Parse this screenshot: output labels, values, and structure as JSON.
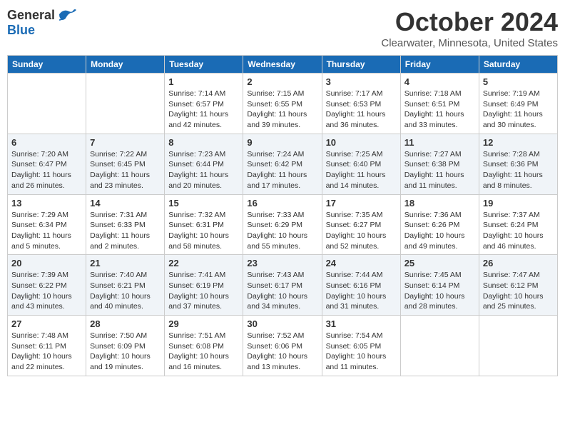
{
  "header": {
    "logo_general": "General",
    "logo_blue": "Blue",
    "month_title": "October 2024",
    "location": "Clearwater, Minnesota, United States"
  },
  "weekdays": [
    "Sunday",
    "Monday",
    "Tuesday",
    "Wednesday",
    "Thursday",
    "Friday",
    "Saturday"
  ],
  "weeks": [
    [
      {
        "day": "",
        "info": ""
      },
      {
        "day": "",
        "info": ""
      },
      {
        "day": "1",
        "info": "Sunrise: 7:14 AM\nSunset: 6:57 PM\nDaylight: 11 hours and 42 minutes."
      },
      {
        "day": "2",
        "info": "Sunrise: 7:15 AM\nSunset: 6:55 PM\nDaylight: 11 hours and 39 minutes."
      },
      {
        "day": "3",
        "info": "Sunrise: 7:17 AM\nSunset: 6:53 PM\nDaylight: 11 hours and 36 minutes."
      },
      {
        "day": "4",
        "info": "Sunrise: 7:18 AM\nSunset: 6:51 PM\nDaylight: 11 hours and 33 minutes."
      },
      {
        "day": "5",
        "info": "Sunrise: 7:19 AM\nSunset: 6:49 PM\nDaylight: 11 hours and 30 minutes."
      }
    ],
    [
      {
        "day": "6",
        "info": "Sunrise: 7:20 AM\nSunset: 6:47 PM\nDaylight: 11 hours and 26 minutes."
      },
      {
        "day": "7",
        "info": "Sunrise: 7:22 AM\nSunset: 6:45 PM\nDaylight: 11 hours and 23 minutes."
      },
      {
        "day": "8",
        "info": "Sunrise: 7:23 AM\nSunset: 6:44 PM\nDaylight: 11 hours and 20 minutes."
      },
      {
        "day": "9",
        "info": "Sunrise: 7:24 AM\nSunset: 6:42 PM\nDaylight: 11 hours and 17 minutes."
      },
      {
        "day": "10",
        "info": "Sunrise: 7:25 AM\nSunset: 6:40 PM\nDaylight: 11 hours and 14 minutes."
      },
      {
        "day": "11",
        "info": "Sunrise: 7:27 AM\nSunset: 6:38 PM\nDaylight: 11 hours and 11 minutes."
      },
      {
        "day": "12",
        "info": "Sunrise: 7:28 AM\nSunset: 6:36 PM\nDaylight: 11 hours and 8 minutes."
      }
    ],
    [
      {
        "day": "13",
        "info": "Sunrise: 7:29 AM\nSunset: 6:34 PM\nDaylight: 11 hours and 5 minutes."
      },
      {
        "day": "14",
        "info": "Sunrise: 7:31 AM\nSunset: 6:33 PM\nDaylight: 11 hours and 2 minutes."
      },
      {
        "day": "15",
        "info": "Sunrise: 7:32 AM\nSunset: 6:31 PM\nDaylight: 10 hours and 58 minutes."
      },
      {
        "day": "16",
        "info": "Sunrise: 7:33 AM\nSunset: 6:29 PM\nDaylight: 10 hours and 55 minutes."
      },
      {
        "day": "17",
        "info": "Sunrise: 7:35 AM\nSunset: 6:27 PM\nDaylight: 10 hours and 52 minutes."
      },
      {
        "day": "18",
        "info": "Sunrise: 7:36 AM\nSunset: 6:26 PM\nDaylight: 10 hours and 49 minutes."
      },
      {
        "day": "19",
        "info": "Sunrise: 7:37 AM\nSunset: 6:24 PM\nDaylight: 10 hours and 46 minutes."
      }
    ],
    [
      {
        "day": "20",
        "info": "Sunrise: 7:39 AM\nSunset: 6:22 PM\nDaylight: 10 hours and 43 minutes."
      },
      {
        "day": "21",
        "info": "Sunrise: 7:40 AM\nSunset: 6:21 PM\nDaylight: 10 hours and 40 minutes."
      },
      {
        "day": "22",
        "info": "Sunrise: 7:41 AM\nSunset: 6:19 PM\nDaylight: 10 hours and 37 minutes."
      },
      {
        "day": "23",
        "info": "Sunrise: 7:43 AM\nSunset: 6:17 PM\nDaylight: 10 hours and 34 minutes."
      },
      {
        "day": "24",
        "info": "Sunrise: 7:44 AM\nSunset: 6:16 PM\nDaylight: 10 hours and 31 minutes."
      },
      {
        "day": "25",
        "info": "Sunrise: 7:45 AM\nSunset: 6:14 PM\nDaylight: 10 hours and 28 minutes."
      },
      {
        "day": "26",
        "info": "Sunrise: 7:47 AM\nSunset: 6:12 PM\nDaylight: 10 hours and 25 minutes."
      }
    ],
    [
      {
        "day": "27",
        "info": "Sunrise: 7:48 AM\nSunset: 6:11 PM\nDaylight: 10 hours and 22 minutes."
      },
      {
        "day": "28",
        "info": "Sunrise: 7:50 AM\nSunset: 6:09 PM\nDaylight: 10 hours and 19 minutes."
      },
      {
        "day": "29",
        "info": "Sunrise: 7:51 AM\nSunset: 6:08 PM\nDaylight: 10 hours and 16 minutes."
      },
      {
        "day": "30",
        "info": "Sunrise: 7:52 AM\nSunset: 6:06 PM\nDaylight: 10 hours and 13 minutes."
      },
      {
        "day": "31",
        "info": "Sunrise: 7:54 AM\nSunset: 6:05 PM\nDaylight: 10 hours and 11 minutes."
      },
      {
        "day": "",
        "info": ""
      },
      {
        "day": "",
        "info": ""
      }
    ]
  ]
}
